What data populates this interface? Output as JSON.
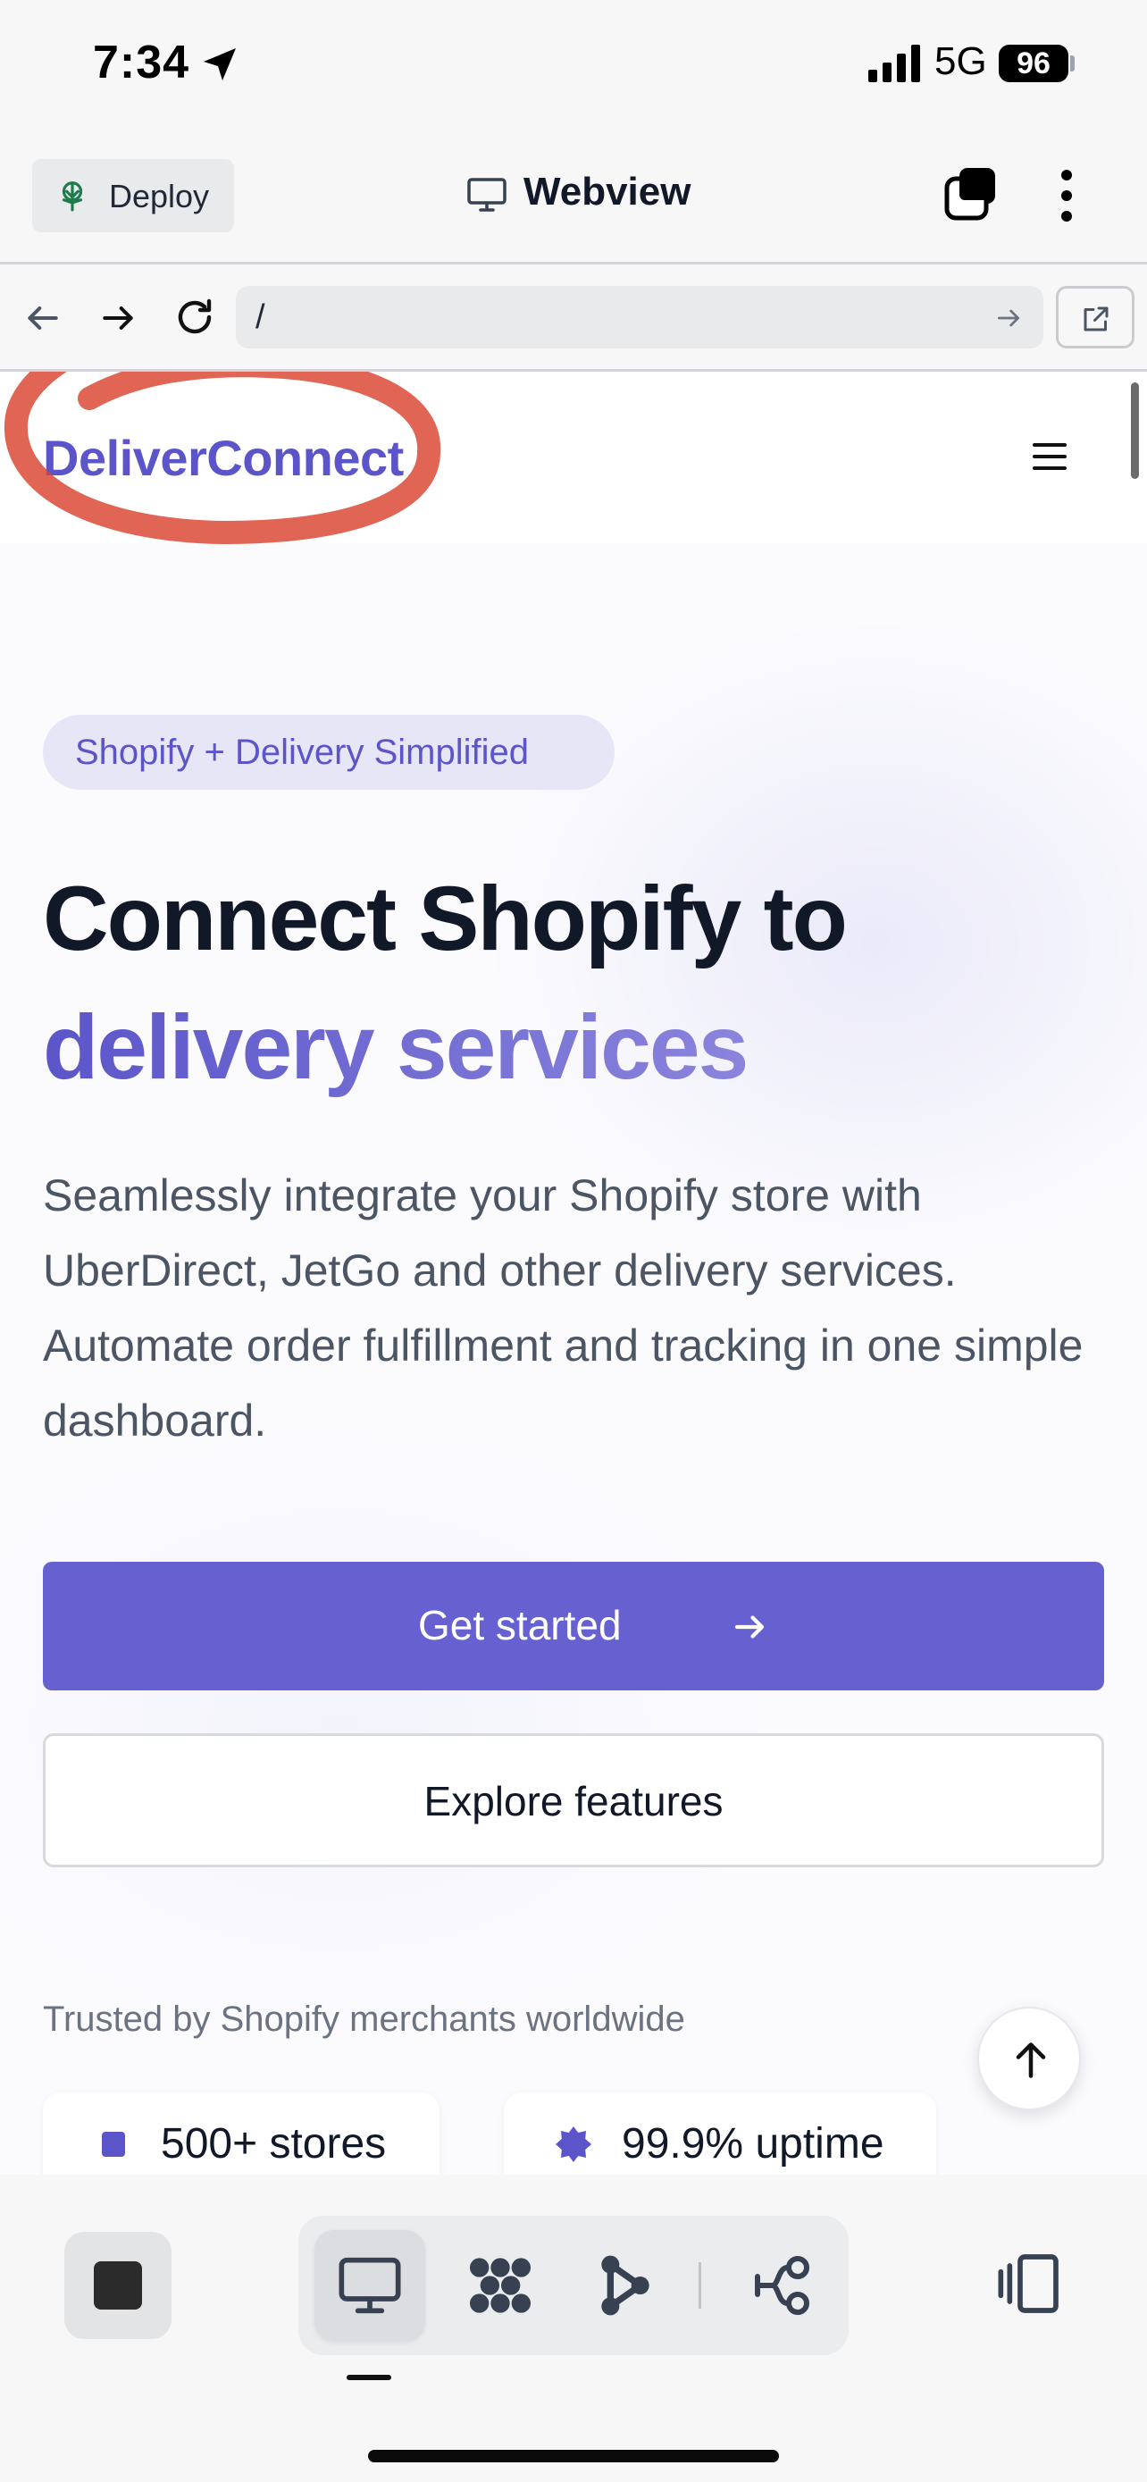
{
  "status_bar": {
    "time": "7:34",
    "network": "5G",
    "battery": "96"
  },
  "app_bar": {
    "deploy_label": "Deploy",
    "title": "Webview"
  },
  "browser": {
    "url": "/"
  },
  "site": {
    "brand": "DeliverConnect",
    "badge": "Shopify + Delivery Simplified",
    "headline_line1": "Connect Shopify to",
    "headline_accent": "delivery services",
    "description": "Seamlessly integrate your Shopify store with UberDirect, JetGo and other delivery services. Automate order fulfillment and tracking in one simple dashboard.",
    "primary_cta": "Get started",
    "secondary_cta": "Explore features",
    "trusted_label": "Trusted by Shopify merchants worldwide",
    "stats": [
      {
        "label": "500+ stores",
        "icon": "square-icon"
      },
      {
        "label": "99.9% uptime",
        "icon": "badge-star-icon"
      }
    ]
  },
  "colors": {
    "brand": "#5b55c9",
    "primary_button": "#6660d0",
    "annotation": "#d9432e",
    "heading": "#111827",
    "body_text": "#4b5563"
  },
  "bottom_bar": {
    "tools": [
      "webview-icon",
      "grid-icon",
      "flow-icon",
      "tree-icon"
    ],
    "active_tool": "webview-icon"
  }
}
